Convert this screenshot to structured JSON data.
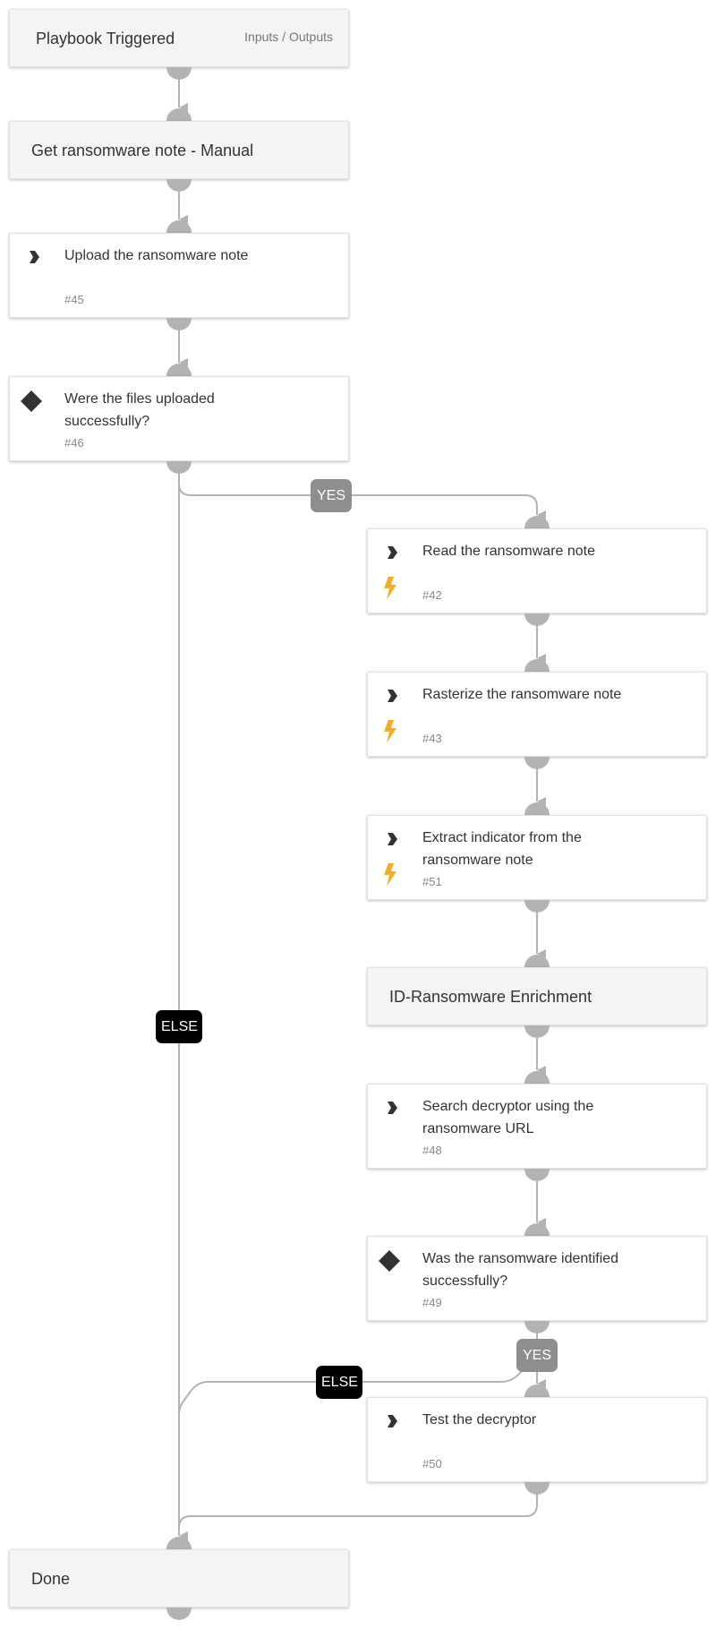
{
  "start": {
    "title": "Playbook Triggered",
    "link": "Inputs / Outputs"
  },
  "nodes": [
    {
      "kind": "section",
      "title": "Get ransomware note - Manual"
    },
    {
      "kind": "task",
      "icon": "chevron-right-icon",
      "title": "Upload the ransomware note",
      "id": "#45",
      "automated": false
    },
    {
      "kind": "condition",
      "icon": "diamond-icon",
      "title": "Were the files uploaded successfully?",
      "id": "#46",
      "automated": false
    },
    {
      "kind": "task",
      "icon": "chevron-right-icon",
      "title": "Read the ransomware note",
      "id": "#42",
      "automated": true
    },
    {
      "kind": "task",
      "icon": "chevron-right-icon",
      "title": "Rasterize the ransomware note",
      "id": "#43",
      "automated": true
    },
    {
      "kind": "task",
      "icon": "chevron-right-icon",
      "title": "Extract indicator from the ransomware note",
      "id": "#51",
      "automated": true
    },
    {
      "kind": "section",
      "title": "ID-Ransomware Enrichment"
    },
    {
      "kind": "task",
      "icon": "chevron-right-icon",
      "title": "Search decryptor using the ransomware URL",
      "id": "#48",
      "automated": false
    },
    {
      "kind": "condition",
      "icon": "diamond-icon",
      "title": "Was the ransomware identified successfully?",
      "id": "#49",
      "automated": false
    },
    {
      "kind": "task",
      "icon": "chevron-right-icon",
      "title": "Test the decryptor",
      "id": "#50",
      "automated": false
    }
  ],
  "end": {
    "title": "Done"
  },
  "branches": {
    "yes_label": "YES",
    "else_label": "ELSE"
  },
  "colors": {
    "edge": "#b3b3b3",
    "yes_badge": "#8e8e8e",
    "else_badge": "#000000",
    "automation_bolt": "#f0ad2e",
    "icon": "#333333"
  }
}
